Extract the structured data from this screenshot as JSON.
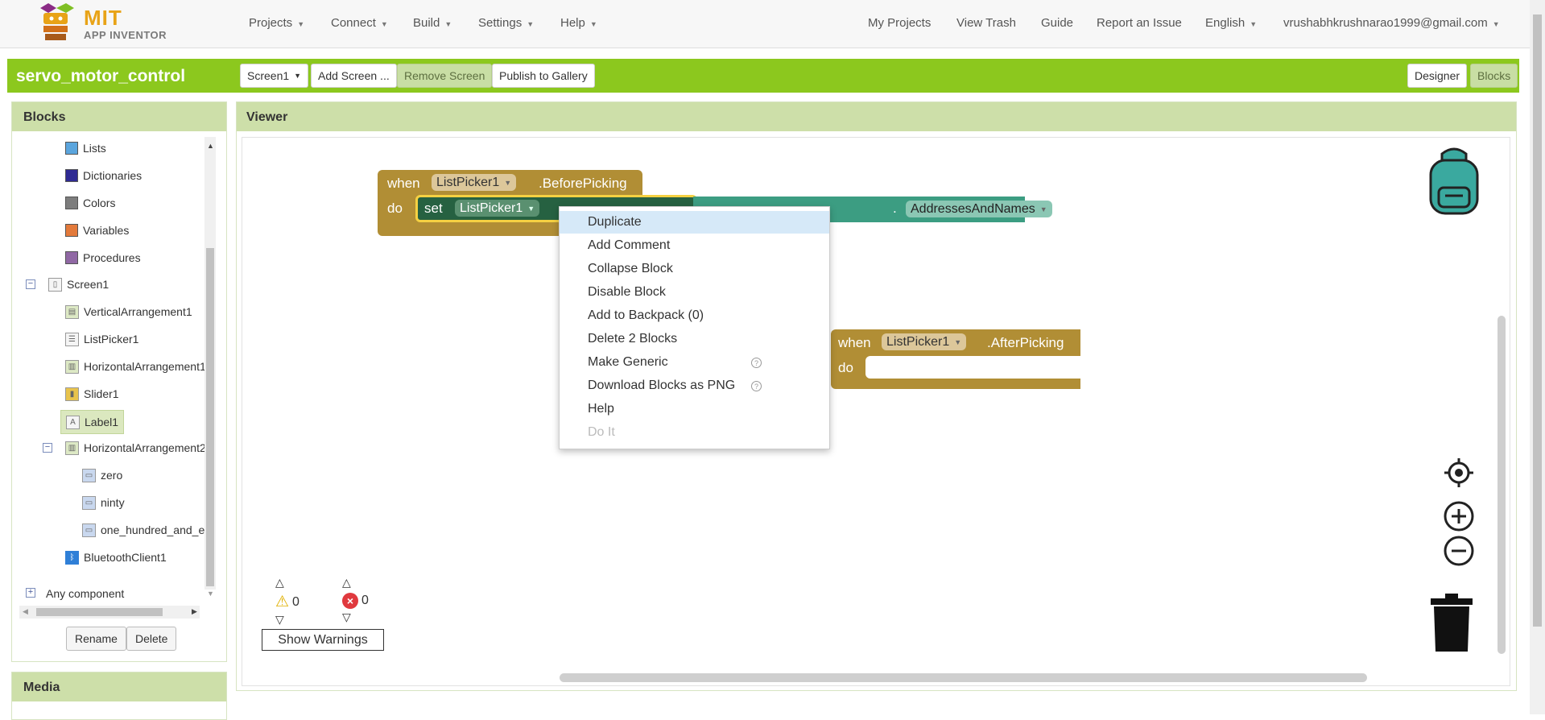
{
  "nav": {
    "logo_line1": "MIT",
    "logo_line2": "APP INVENTOR",
    "projects": "Projects",
    "connect": "Connect",
    "build": "Build",
    "settings": "Settings",
    "help": "Help",
    "my_projects": "My Projects",
    "view_trash": "View Trash",
    "guide": "Guide",
    "report": "Report an Issue",
    "language": "English",
    "account": "vrushabhkrushnarao1999@gmail.com"
  },
  "project": {
    "title": "servo_motor_control",
    "screen_select": "Screen1",
    "add_screen": "Add Screen ...",
    "remove_screen": "Remove Screen",
    "publish": "Publish to Gallery",
    "designer": "Designer",
    "blocks": "Blocks"
  },
  "blocks_panel": {
    "header": "Blocks",
    "builtin": [
      {
        "label": "Lists",
        "color": "#5ba5dd"
      },
      {
        "label": "Dictionaries",
        "color": "#2f2a93"
      },
      {
        "label": "Colors",
        "color": "#7d7d7d"
      },
      {
        "label": "Variables",
        "color": "#e37a3b"
      },
      {
        "label": "Procedures",
        "color": "#9068a4"
      }
    ],
    "screen": "Screen1",
    "components": [
      "VerticalArrangement1",
      "ListPicker1",
      "HorizontalArrangement1",
      "Slider1",
      "Label1",
      "HorizontalArrangement2",
      "zero",
      "ninty",
      "one_hundred_and_eighty",
      "BluetoothClient1"
    ],
    "any_component": "Any component",
    "rename": "Rename",
    "delete": "Delete"
  },
  "media_panel": {
    "header": "Media"
  },
  "viewer": {
    "header": "Viewer",
    "block1": {
      "when": "when",
      "component": "ListPicker1",
      "event": ".BeforePicking",
      "do": "do",
      "set": "set",
      "set_component": "ListPicker1",
      "dot": ".",
      "addresses": "AddressesAndNames"
    },
    "block2": {
      "when": "when",
      "component": "ListPicker1",
      "event": ".AfterPicking",
      "do": "do"
    },
    "context_menu": [
      "Duplicate",
      "Add Comment",
      "Collapse Block",
      "Disable Block",
      "Add to Backpack (0)",
      "Delete 2 Blocks",
      "Make Generic",
      "Download Blocks as PNG",
      "Help",
      "Do It"
    ],
    "warnings_count": "0",
    "errors_count": "0",
    "show_warnings": "Show Warnings"
  },
  "colors": {
    "project_bar": "#8cc81e",
    "panel_header": "#cddfa9",
    "event_block": "#b18e35",
    "set_block": "#266141",
    "bluetooth_block": "#3c9d82"
  }
}
